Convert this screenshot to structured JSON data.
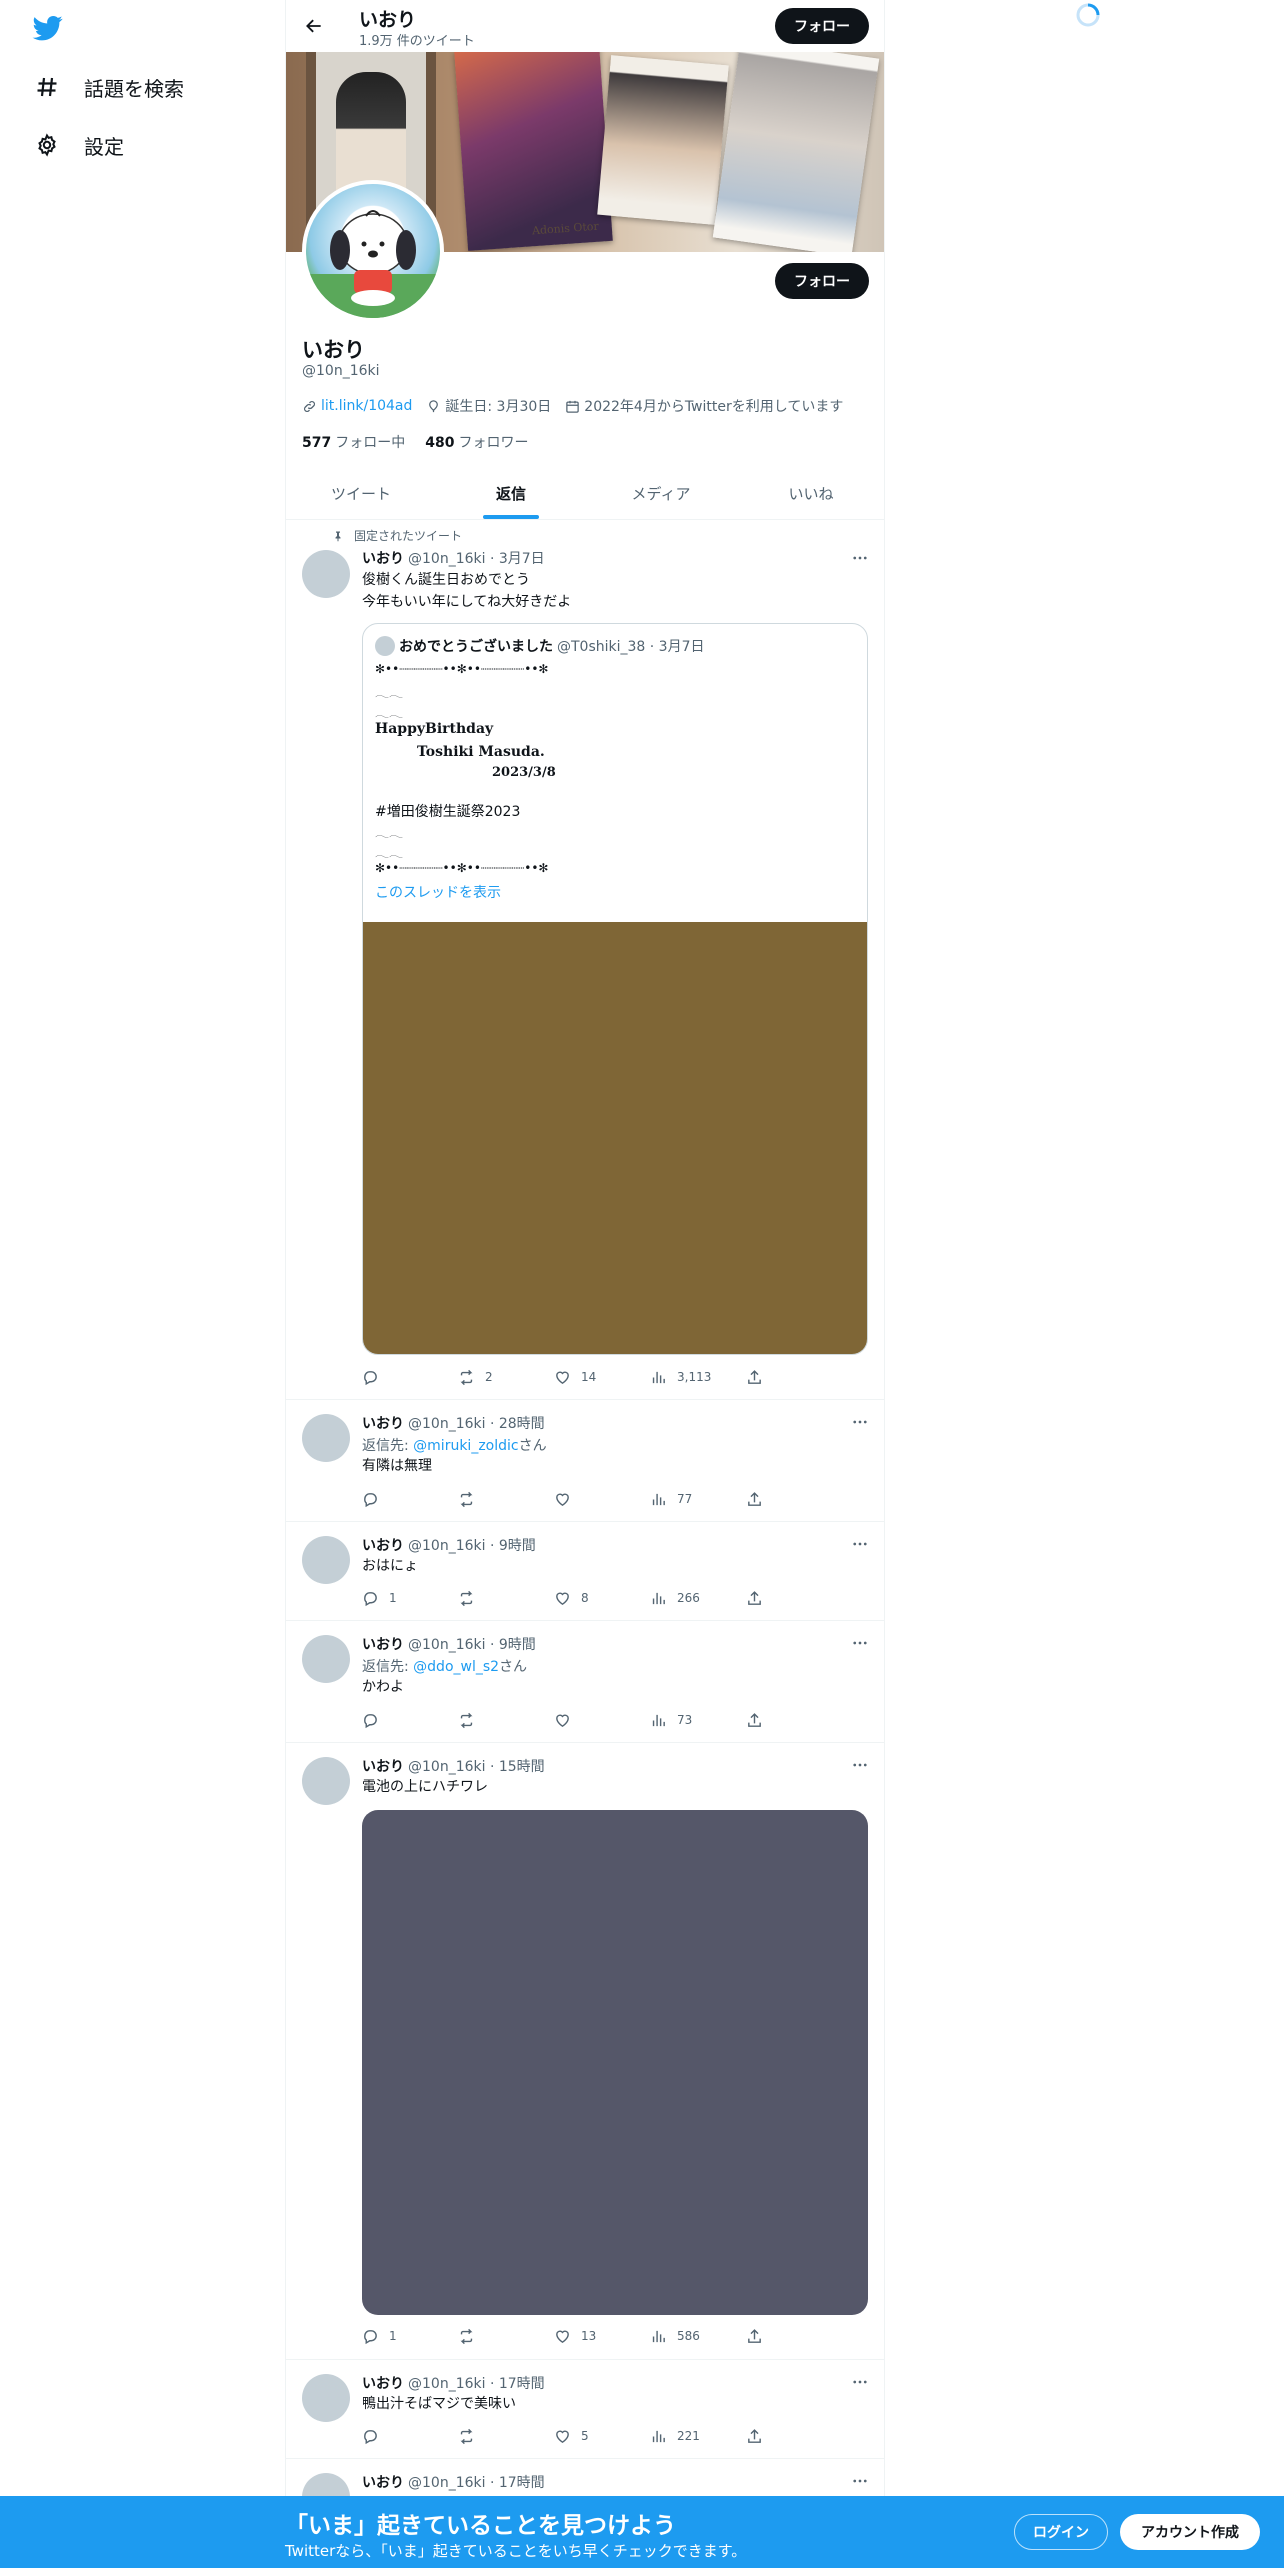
{
  "nav": {
    "items": [
      {
        "label": "話題を検索",
        "icon": "hashtag-icon"
      },
      {
        "label": "設定",
        "icon": "gear-icon"
      }
    ]
  },
  "header": {
    "name": "いおり",
    "tweet_count": "1.9万 件のツイート",
    "follow_label": "フォロー"
  },
  "profile": {
    "name": "いおり",
    "handle": "@10n_16ki",
    "link": "lit.link/104ad",
    "birthday": "誕生日: 3月30日",
    "joined": "2022年4月からTwitterを利用しています",
    "following_count": "577",
    "following_label": "フォロー中",
    "followers_count": "480",
    "followers_label": "フォロワー",
    "follow_label": "フォロー",
    "banner_caption": "Adonis Otor"
  },
  "tabs": [
    "ツイート",
    "返信",
    "メディア",
    "いいね"
  ],
  "tweets": [
    {
      "pinned_label": "固定されたツイート",
      "name": "いおり",
      "meta": "@10n_16ki · 3月7日",
      "text1": "俊樹くん誕生日おめでとう",
      "text2": "今年もいい年にしてね大好きだよ",
      "quote": {
        "name": "おめでとうございました",
        "meta": "@T0shiki_38 · 3月7日",
        "lines": [
          "✻••┈┈┈┈┈┈••✻••┈┈┈┈┈┈••✻",
          "𓂃𓂃",
          "𓂃𓂃",
          "HappyBirthday",
          "　　　Toshiki Masuda.",
          "　　　　　　　　　2023/3/8",
          "",
          "#増田俊樹生誕祭2023",
          "𓂃𓂃",
          "𓂃𓂃",
          "✻••┈┈┈┈┈┈••✻••┈┈┈┈┈┈••✻"
        ],
        "show_thread": "このスレッドを表示"
      },
      "replies": "",
      "retweets": "2",
      "likes": "14",
      "views": "3,113"
    },
    {
      "name": "いおり",
      "meta": "@10n_16ki · 28時間",
      "reply_prefix": "返信先: ",
      "reply_to": "@miruki_zoldic",
      "reply_suffix": "さん",
      "text1": "有隣は無理",
      "replies": "",
      "retweets": "",
      "likes": "",
      "views": "77"
    },
    {
      "name": "いおり",
      "meta": "@10n_16ki · 9時間",
      "text1": "おはにょ",
      "replies": "1",
      "retweets": "",
      "likes": "8",
      "views": "266"
    },
    {
      "name": "いおり",
      "meta": "@10n_16ki · 9時間",
      "reply_prefix": "返信先: ",
      "reply_to": "@ddo_wl_s2",
      "reply_suffix": "さん",
      "text1": "かわよ",
      "replies": "",
      "retweets": "",
      "likes": "",
      "views": "73"
    },
    {
      "name": "いおり",
      "meta": "@10n_16ki · 15時間",
      "text1": "電池の上にハチワレ",
      "replies": "1",
      "retweets": "",
      "likes": "13",
      "views": "586"
    },
    {
      "name": "いおり",
      "meta": "@10n_16ki · 17時間",
      "text1": "鴨出汁そばマジで美味い",
      "replies": "",
      "retweets": "",
      "likes": "5",
      "views": "221"
    },
    {
      "name": "いおり",
      "meta": "@10n_16ki · 17時間"
    }
  ],
  "bottom_bar": {
    "title": "「いま」起きていることを見つけよう",
    "subtitle": "Twitterなら、「いま」起きていることをいち早くチェックできます。",
    "login": "ログイン",
    "signup": "アカウント作成"
  },
  "colors": {
    "accent": "#1d9bf0",
    "quote_media": "#7f6636",
    "tweet_media": "#555769"
  }
}
